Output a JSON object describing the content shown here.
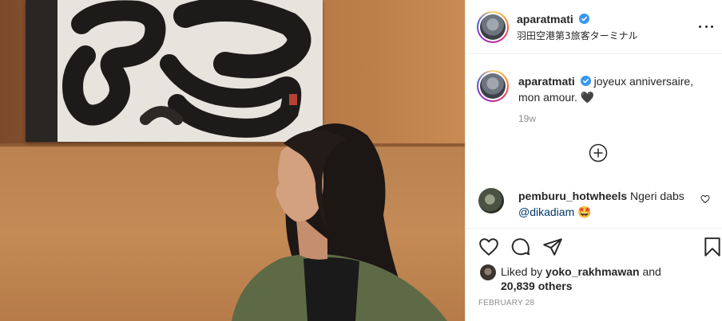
{
  "post": {
    "author": "aparatmati",
    "location": "羽田空港第3旅客ターミナル",
    "caption_author": "aparatmati",
    "caption_text": "joyeux anniversaire, mon amour.",
    "caption_emoji": "🖤",
    "time_ago": "19w",
    "date": "FEBRUARY 28"
  },
  "comments": [
    {
      "user": "pemburu_hotwheels",
      "text": "Ngeri dabs",
      "mention": "@dikadiam",
      "emoji": "🤩"
    }
  ],
  "likes": {
    "prefix": "Liked by",
    "user": "yoko_rakhmawan",
    "joiner": "and",
    "others": "20,839 others"
  },
  "icons": {
    "verified": "verified-badge-icon",
    "more": "more-options-icon",
    "load_more": "plus-circle-icon",
    "like": "heart-icon",
    "comment": "comment-bubble-icon",
    "share": "paper-plane-icon",
    "save": "bookmark-icon"
  },
  "colors": {
    "verified_blue": "#3897f0",
    "mention_blue": "#00376b",
    "muted_gray": "#8e8e8e",
    "border": "#efefef"
  }
}
